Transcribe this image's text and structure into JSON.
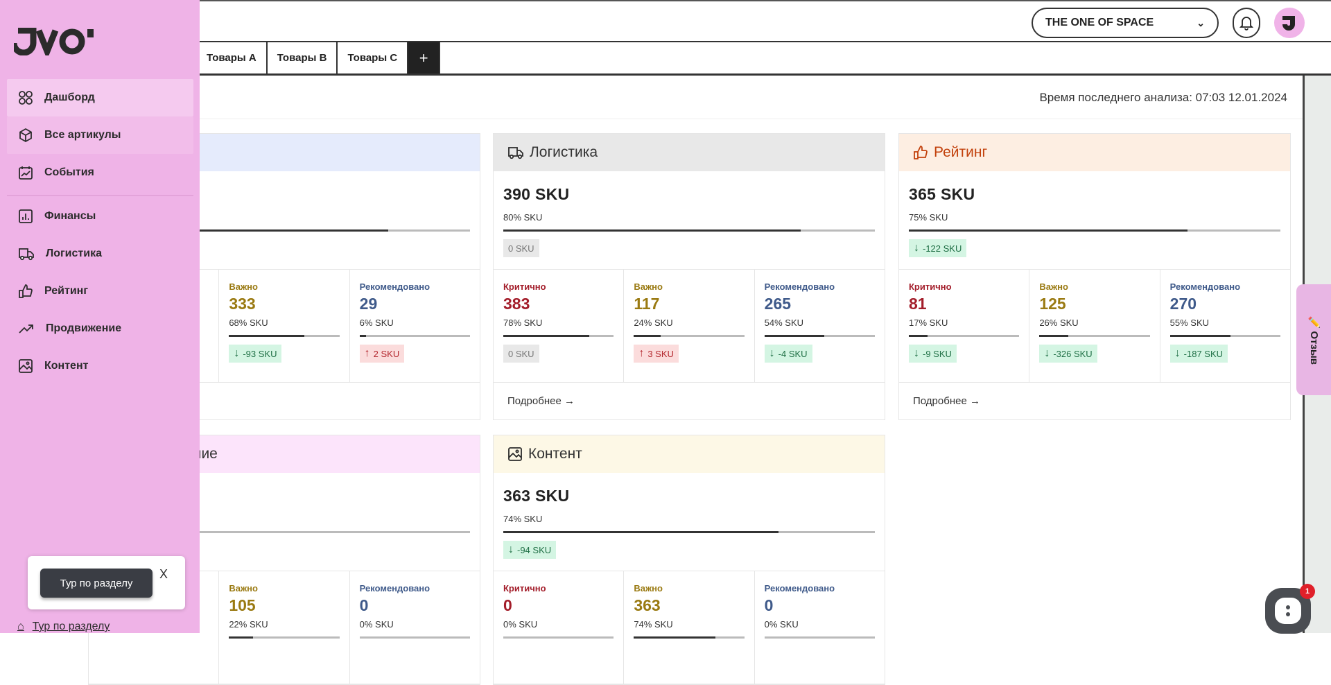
{
  "header": {
    "workspace": "THE ONE OF SPACE",
    "avatar_letter": "J"
  },
  "tabs": [
    {
      "label": "Товары А"
    },
    {
      "label": "Товары В"
    },
    {
      "label": "Товары С"
    },
    {
      "label": "+"
    }
  ],
  "main": {
    "analysis_time": "Время последнего анализа: 07:03 12.01.2024"
  },
  "labels": {
    "critical": "Критично",
    "important": "Важно",
    "recommended": "Рекомендовано",
    "more": "Подробнее →"
  },
  "colors": {
    "critical": "#a31d2a",
    "important": "#9a7a12",
    "recommended": "#3f5a8a",
    "sidebar": "#efb3e7"
  },
  "cards": [
    {
      "id": "finance",
      "title": "",
      "icon": "chart-icon",
      "header_color": "#e5ebfc",
      "total": "",
      "total_pct": "",
      "total_fill": 78,
      "delta": null,
      "subs": [
        {
          "type": "critical",
          "hidden": true
        },
        {
          "type": "important",
          "value": "333",
          "pct": "68% SKU",
          "fill": 68,
          "delta": {
            "dir": "down",
            "text": "-93 SKU"
          }
        },
        {
          "type": "recommended",
          "value": "29",
          "pct": "6% SKU",
          "fill": 6,
          "delta": {
            "dir": "up",
            "text": "2 SKU"
          }
        }
      ],
      "more": true
    },
    {
      "id": "logistics",
      "title": "Логистика",
      "icon": "truck-icon",
      "header_color": "#e8e8e8",
      "total": "390 SKU",
      "total_pct": "80% SKU",
      "total_fill": 80,
      "delta": {
        "dir": "none",
        "text": "0 SKU"
      },
      "subs": [
        {
          "type": "critical",
          "value": "383",
          "pct": "78% SKU",
          "fill": 78,
          "delta": {
            "dir": "none",
            "text": "0 SKU"
          }
        },
        {
          "type": "important",
          "value": "117",
          "pct": "24% SKU",
          "fill": 24,
          "delta": {
            "dir": "up",
            "text": "3 SKU"
          }
        },
        {
          "type": "recommended",
          "value": "265",
          "pct": "54% SKU",
          "fill": 54,
          "delta": {
            "dir": "down",
            "text": "-4 SKU"
          }
        }
      ],
      "more": true
    },
    {
      "id": "rating",
      "title": "Рейтинг",
      "icon": "thumbs-up-icon",
      "header_color": "#fdeee2",
      "title_color": "#c2410c",
      "total": "365 SKU",
      "total_pct": "75% SKU",
      "total_fill": 75,
      "delta": {
        "dir": "down",
        "text": "-122 SKU"
      },
      "subs": [
        {
          "type": "critical",
          "value": "81",
          "pct": "17% SKU",
          "fill": 17,
          "delta": {
            "dir": "down",
            "text": "-9 SKU"
          }
        },
        {
          "type": "important",
          "value": "125",
          "pct": "26% SKU",
          "fill": 26,
          "delta": {
            "dir": "down",
            "text": "-326 SKU"
          }
        },
        {
          "type": "recommended",
          "value": "270",
          "pct": "55% SKU",
          "fill": 55,
          "delta": {
            "dir": "down",
            "text": "-187 SKU"
          }
        }
      ],
      "more": true
    },
    {
      "id": "promotion",
      "title": "Продвижение",
      "icon": "trend-icon",
      "header_color": "#fce4fb",
      "total": "",
      "total_pct": "",
      "total_fill": 0,
      "delta": null,
      "subs": [
        {
          "type": "critical",
          "hidden": true
        },
        {
          "type": "important",
          "value": "105",
          "pct": "22% SKU",
          "fill": 22
        },
        {
          "type": "recommended",
          "value": "0",
          "pct": "0% SKU",
          "fill": 0
        }
      ],
      "more": false
    },
    {
      "id": "content",
      "title": "Контент",
      "icon": "image-icon",
      "header_color": "#fdf8e6",
      "total": "363 SKU",
      "total_pct": "74% SKU",
      "total_fill": 74,
      "delta": {
        "dir": "down",
        "text": "-94 SKU"
      },
      "subs": [
        {
          "type": "critical",
          "value": "0",
          "pct": "0% SKU",
          "fill": 0
        },
        {
          "type": "important",
          "value": "363",
          "pct": "74% SKU",
          "fill": 74
        },
        {
          "type": "recommended",
          "value": "0",
          "pct": "0% SKU",
          "fill": 0
        }
      ],
      "more": false
    }
  ],
  "sidebar": {
    "logo": "JVO'",
    "items": [
      {
        "label": "Дашборд",
        "icon": "grid-icon"
      },
      {
        "label": "Все артикулы",
        "icon": "box-icon"
      },
      {
        "label": "События",
        "icon": "calendar-icon"
      },
      {
        "label": "Финансы",
        "icon": "chart-icon"
      },
      {
        "label": "Логистика",
        "icon": "truck-icon"
      },
      {
        "label": "Рейтинг",
        "icon": "thumbs-up-icon"
      },
      {
        "label": "Продвижение",
        "icon": "trend-icon"
      },
      {
        "label": "Контент",
        "icon": "image-icon"
      }
    ],
    "tour_bottom": "Тур по разделу"
  },
  "tour_popup": {
    "button": "Тур по разделу",
    "close": "X"
  },
  "feedback": {
    "label": "✏️ Отзыв"
  },
  "chat": {
    "badge": "1"
  }
}
